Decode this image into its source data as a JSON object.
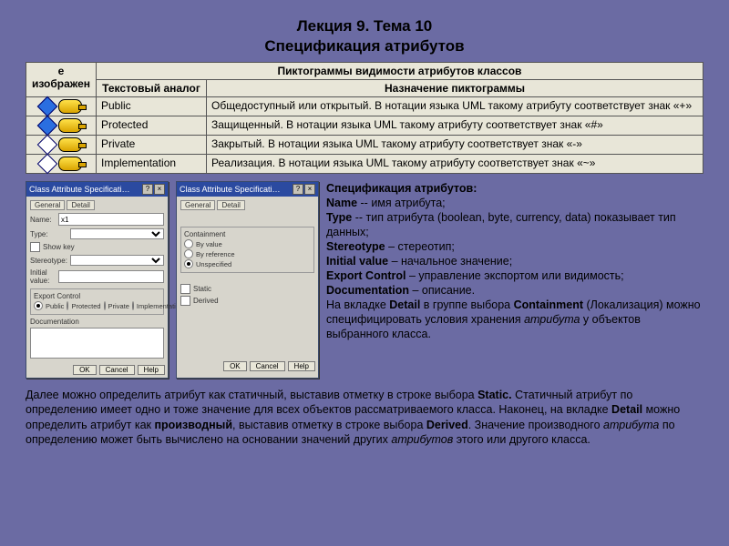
{
  "title_line1": "Лекция 9. Тема 10",
  "title_line2": "Спецификация атрибутов",
  "table": {
    "header_top": "Пиктограммы видимости атрибутов классов",
    "col_icon": "е изображен",
    "col_text": "Текстовый аналог",
    "col_desc": "Назначение пиктограммы",
    "rows": [
      {
        "text": "Public",
        "desc": "Общедоступный или открытый. В нотации языка UML такому атрибуту соответствует знак «+»"
      },
      {
        "text": "Protected",
        "desc": "Защищенный. В нотации языка UML такому атрибуту соответствует знак «#»"
      },
      {
        "text": "Private",
        "desc": "Закрытый. В нотации языка UML такому атрибуту соответствует знак «-»"
      },
      {
        "text": "Implementation",
        "desc": "Реализация. В нотации языка UML такому атрибуту соответствует знак «~»"
      }
    ]
  },
  "dialog": {
    "title": "Class Attribute Specificati…",
    "tab_general": "General",
    "tab_detail": "Detail",
    "lbl_name": "Name:",
    "lbl_type": "Type:",
    "lbl_stereo": "Stereotype:",
    "lbl_init": "Initial value:",
    "grp_export": "Export Control",
    "opt_public": "Public",
    "opt_protected": "Protected",
    "opt_private": "Private",
    "opt_impl": "Implementation",
    "lbl_doc": "Documentation",
    "grp_containment": "Containment",
    "opt_byval": "By value",
    "opt_byref": "By reference",
    "opt_unspec": "Unspecified",
    "chk_static": "Static",
    "chk_derived": "Derived",
    "btn_ok": "OK",
    "btn_cancel": "Cancel",
    "btn_help": "Help",
    "val_name": "x1",
    "show_key": "Show key"
  },
  "spec": {
    "heading": "Спецификация атрибутов:",
    "name_lbl": "Name",
    "name_txt": " -- имя атрибута;",
    "type_lbl": "Type",
    "type_txt": " -- тип атрибута (boolean, byte, currency, data) показывает тип данных;",
    "stereo_lbl": "Stereotype",
    "stereo_txt": " – стереотип;",
    "init_lbl": "Initial value",
    "init_txt": " – начальное значение;",
    "exp_lbl": "Export Control",
    "exp_txt": " – управление экспортом или видимость;",
    "doc_lbl": "Documentation",
    "doc_txt": " – описание.",
    "tail1": "На вкладке ",
    "tail1b": "Detail",
    "tail1c": " в группе выбора ",
    "tail1d": "Containment",
    "tail2": " (Локализация) можно специфицировать условия хранения ",
    "tail_it": "атрибута",
    "tail3": " у объектов выбранного класса."
  },
  "bottom": {
    "p1": "Далее можно определить атрибут как статичный, выставив отметку в строке выбора ",
    "p1b": "Static.",
    "p2": " Статичный атрибут по определению имеет одно и тоже значение для всех объектов рассматриваемого класса. Наконец, на вкладке ",
    "p2b": "Detail",
    "p3": " можно определить атрибут как ",
    "p3b": "производный",
    "p4": ", выставив отметку в строке выбора ",
    "p4b": "Derived",
    "p5": ". Значение производного ",
    "p5it": "атрибута",
    "p6": " по определению может быть вычислено на основании значений других ",
    "p6it": "атрибутов",
    "p7": " этого или другого класса."
  }
}
